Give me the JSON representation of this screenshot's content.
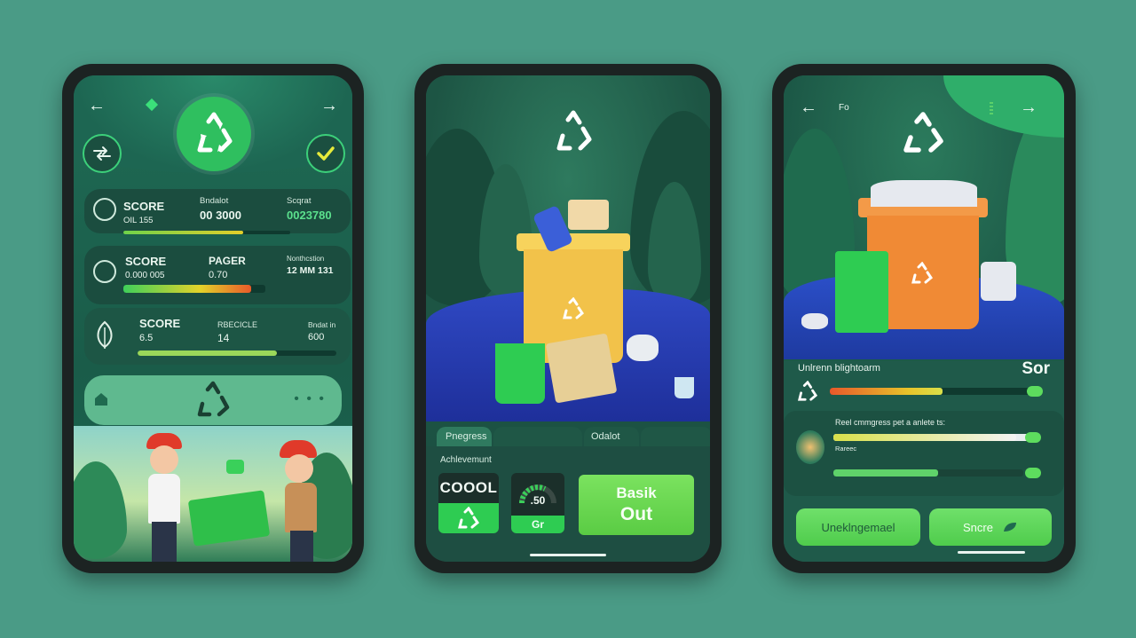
{
  "colors": {
    "background": "#4a9b86",
    "accent_green": "#2fbf5f",
    "bright_green": "#5be08d",
    "water_blue": "#2f49c4",
    "bin_yellow": "#f2c24a",
    "bin_orange": "#f08a35"
  },
  "screen1": {
    "icons": [
      "back-arrow-icon",
      "diamond-icon",
      "recycle-icon",
      "forward-arrow-icon",
      "swap-icon",
      "checkmark-icon",
      "leaf-icon",
      "recycle-icon",
      "more-dots-icon"
    ],
    "stats": [
      {
        "label": "SCORE",
        "value": "OIL 155",
        "mid_label": "Bndalot",
        "mid_value": "00 3000",
        "right_label": "Scqrat",
        "right_value": "0023780",
        "progress": 0.72
      },
      {
        "label": "SCORE",
        "value": "0.000 005",
        "mid_label": "PAGER",
        "mid_value": "0.70",
        "right_label": "Nonthcstion",
        "right_value": "12 MM 131",
        "progress": 0.9
      },
      {
        "label": "SCORE",
        "value": "6.5",
        "mid_label": "RBECICLE",
        "mid_value": "14",
        "right_label": "Bndat in",
        "right_value": "600",
        "progress": 0.7
      }
    ],
    "banner_dots": "• • •"
  },
  "screen2": {
    "tabs": [
      "Pnegress",
      "Odalot"
    ],
    "section_title": "Achlevemunt",
    "tile_cool": "COOOL",
    "tile_gauge_value": ".50",
    "tile_gauge_label": "Gr",
    "big_button": {
      "line1": "Basik",
      "line2": "Out"
    }
  },
  "screen3": {
    "header_text": "Fo",
    "progress_title": "Unlrenn blightoarm",
    "progress_value": "Sor",
    "progress_fraction": 0.55,
    "tip_text": "Reel cmmgress pet a anlete ts:",
    "task_label": "Rareec",
    "task_progress": [
      0.93,
      0.55
    ],
    "buttons": [
      "Uneklngemael",
      "Sncre"
    ]
  }
}
